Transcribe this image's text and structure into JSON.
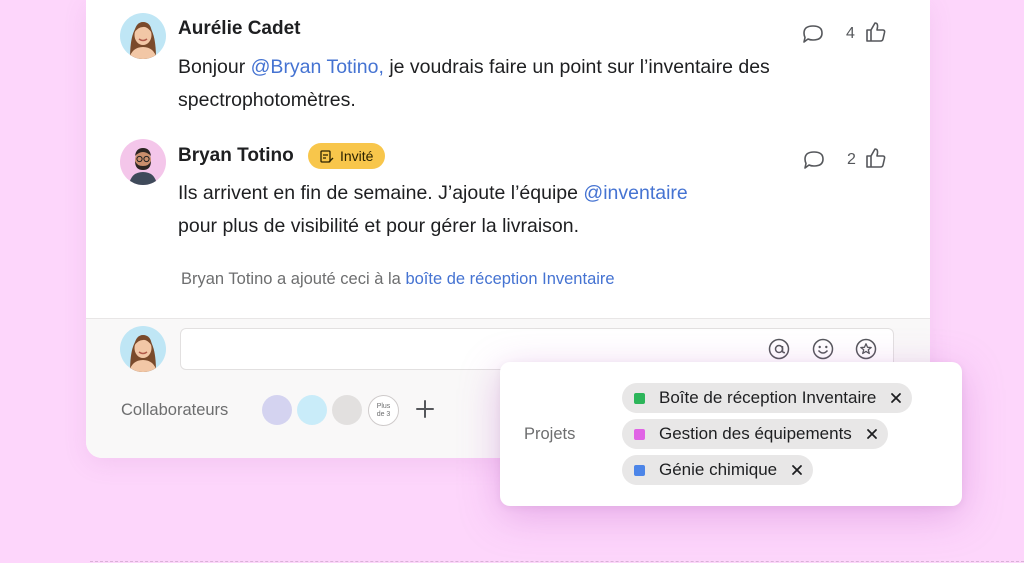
{
  "comments": [
    {
      "author": "Aurélie Cadet",
      "text_parts": [
        "Bonjour ",
        "@Bryan Totino,",
        " je voudrais faire un point sur l’inventaire des",
        "spectrophotomètres."
      ],
      "likes": "4",
      "avatar_icon": "avatar-woman-icon"
    },
    {
      "author": "Bryan Totino",
      "badge": "Invité",
      "text_parts": [
        "Ils arrivent en fin de semaine. J’ajoute l’équipe ",
        "@inventaire",
        "pour plus de visibilité et pour gérer la livraison."
      ],
      "likes": "2",
      "avatar_icon": "avatar-man-icon"
    }
  ],
  "activity": {
    "prefix": "Bryan Totino a ajouté ceci à la",
    "link": "boîte de réception Inventaire"
  },
  "composer": {
    "placeholder": "",
    "tools": [
      "mention-icon",
      "emoji-icon",
      "star-icon"
    ]
  },
  "collaborators": {
    "label": "Collaborateurs",
    "more_line1": "Plus",
    "more_line2": "de 3",
    "dot_colors": [
      "#d4d3f0",
      "#c9ecf9",
      "#e2e0df"
    ]
  },
  "projects_popup": {
    "label": "Projets",
    "projects": [
      {
        "name": "Boîte de réception Inventaire",
        "color": "#2cb55a"
      },
      {
        "name": "Gestion des équipements",
        "color": "#e063e5"
      },
      {
        "name": "Génie chimique",
        "color": "#4c85e8"
      }
    ]
  },
  "colors": {
    "background": "#fdd6fb",
    "mention": "#4573d2",
    "badge": "#f8c64b"
  }
}
